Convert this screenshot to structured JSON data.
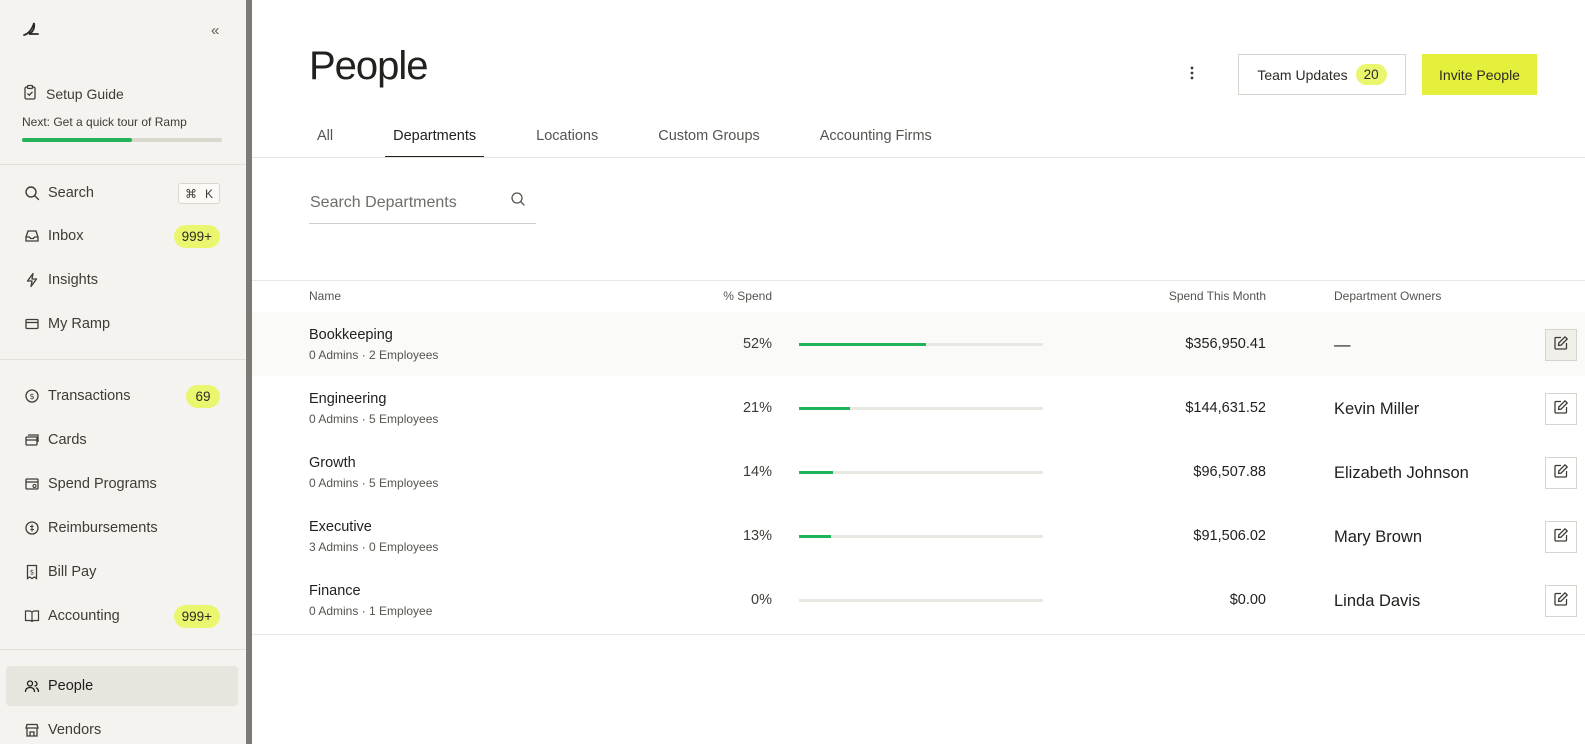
{
  "sidebar": {
    "setup": {
      "title": "Setup Guide",
      "next": "Next: Get a quick tour of Ramp",
      "progress": 0.55
    },
    "search": {
      "label": "Search",
      "shortcut_mod": "⌘",
      "shortcut_key": "K"
    },
    "items_top": [
      {
        "label": "Inbox",
        "badge": "999+",
        "icon": "inbox-icon"
      },
      {
        "label": "Insights",
        "badge": "",
        "icon": "bolt-icon"
      },
      {
        "label": "My Ramp",
        "badge": "",
        "icon": "card-window-icon"
      }
    ],
    "items_mid": [
      {
        "label": "Transactions",
        "badge": "69",
        "icon": "dollar-circle-icon"
      },
      {
        "label": "Cards",
        "badge": "",
        "icon": "cards-icon"
      },
      {
        "label": "Spend Programs",
        "badge": "",
        "icon": "spend-program-icon"
      },
      {
        "label": "Reimbursements",
        "badge": "",
        "icon": "reimburse-icon"
      },
      {
        "label": "Bill Pay",
        "badge": "",
        "icon": "bill-icon"
      },
      {
        "label": "Accounting",
        "badge": "999+",
        "icon": "book-icon"
      }
    ],
    "items_bottom": [
      {
        "label": "People",
        "badge": "",
        "icon": "people-icon",
        "active": true
      },
      {
        "label": "Vendors",
        "badge": "",
        "icon": "store-icon"
      }
    ]
  },
  "header": {
    "title": "People",
    "team_updates_label": "Team Updates",
    "team_updates_count": "20",
    "invite_label": "Invite People"
  },
  "tabs": [
    {
      "label": "All",
      "active": false
    },
    {
      "label": "Departments",
      "active": true
    },
    {
      "label": "Locations",
      "active": false
    },
    {
      "label": "Custom Groups",
      "active": false
    },
    {
      "label": "Accounting Firms",
      "active": false
    }
  ],
  "search": {
    "placeholder": "Search Departments"
  },
  "table": {
    "columns": {
      "name": "Name",
      "pct": "% Spend",
      "spend": "Spend This Month",
      "owners": "Department Owners"
    },
    "rows": [
      {
        "name": "Bookkeeping",
        "sub": "0 Admins · 2 Employees",
        "pct": "52%",
        "fraction": 0.52,
        "spend": "$356,950.41",
        "owner": "—"
      },
      {
        "name": "Engineering",
        "sub": "0 Admins · 5 Employees",
        "pct": "21%",
        "fraction": 0.21,
        "spend": "$144,631.52",
        "owner": "Kevin Miller"
      },
      {
        "name": "Growth",
        "sub": "0 Admins · 5 Employees",
        "pct": "14%",
        "fraction": 0.14,
        "spend": "$96,507.88",
        "owner": "Elizabeth Johnson"
      },
      {
        "name": "Executive",
        "sub": "3 Admins · 0 Employees",
        "pct": "13%",
        "fraction": 0.13,
        "spend": "$91,506.02",
        "owner": "Mary Brown"
      },
      {
        "name": "Finance",
        "sub": "0 Admins · 1 Employee",
        "pct": "0%",
        "fraction": 0.0,
        "spend": "$0.00",
        "owner": "Linda Davis"
      }
    ]
  },
  "colors": {
    "accent": "#e4f03c",
    "badge": "#eaf76e",
    "progress_green": "#22b35a"
  }
}
